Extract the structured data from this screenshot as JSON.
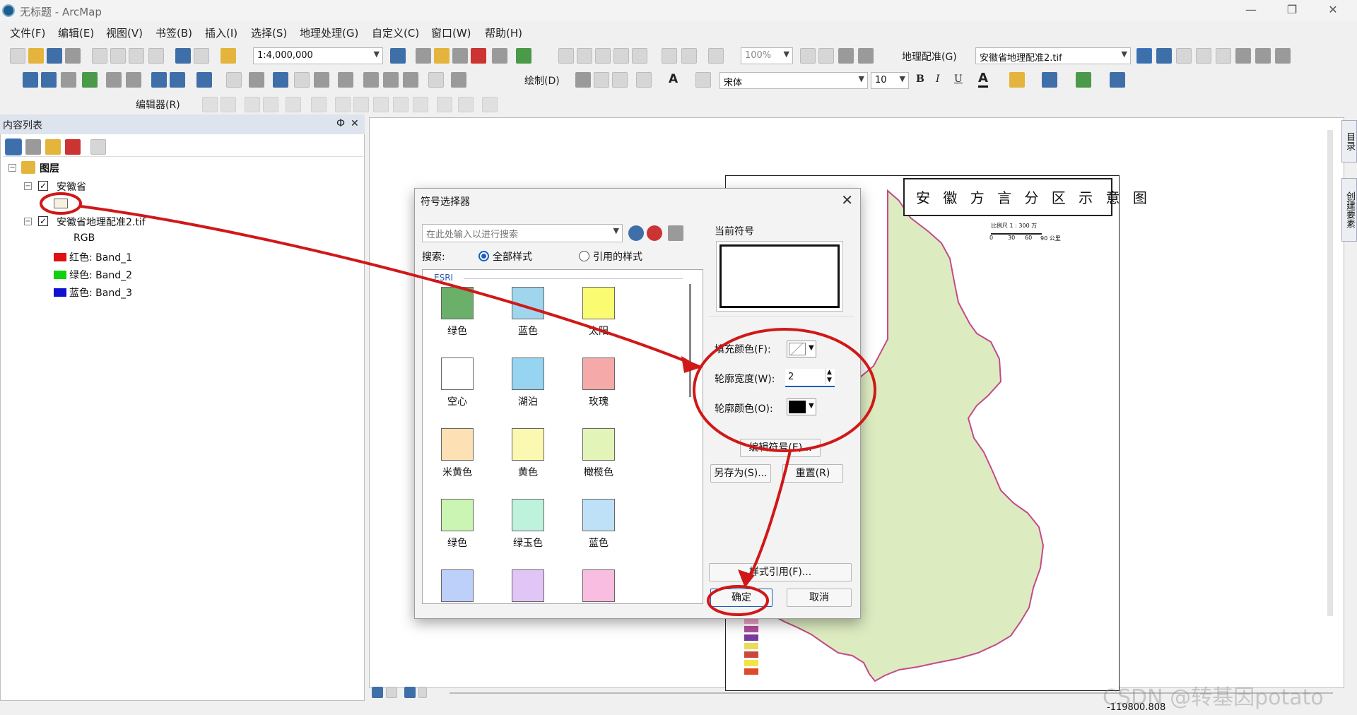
{
  "window": {
    "title": "无标题 - ArcMap"
  },
  "menu": [
    "文件(F)",
    "编辑(E)",
    "视图(V)",
    "书签(B)",
    "插入(I)",
    "选择(S)",
    "地理处理(G)",
    "自定义(C)",
    "窗口(W)",
    "帮助(H)"
  ],
  "toolbar": {
    "scale": "1:4,000,000",
    "zoom": "100%",
    "georef_label": "地理配准(G)",
    "georef_layer": "安徽省地理配准2.tif",
    "draw_label": "绘制(D)",
    "font_name": "宋体",
    "font_size": "10",
    "bold": "B",
    "italic": "I",
    "underline": "U",
    "font_color_letter": "A",
    "editor_label": "编辑器(R)"
  },
  "toc": {
    "title": "内容列表",
    "pin": "Ф",
    "close": "✕",
    "root": "图层",
    "layers": [
      {
        "name": "安徽省"
      },
      {
        "name": "安徽省地理配准2.tif",
        "rgb": "RGB",
        "bands": [
          {
            "label": "红色:   Band_1",
            "color": "#e01010"
          },
          {
            "label": "绿色: Band_2",
            "color": "#10d010"
          },
          {
            "label": "蓝色:   Band_3",
            "color": "#1010d0"
          }
        ]
      }
    ]
  },
  "map": {
    "title": "安 徽 方 言 分 区 示 意 图",
    "scale_note": "比例尺 1 : 300 万",
    "scale_ticks": [
      "0",
      "30",
      "60",
      "90 公里"
    ],
    "fill_color": "#dcebc0",
    "coordinate": "-119800.808"
  },
  "dialog": {
    "title": "符号选择器",
    "close": "✕",
    "search_placeholder": "在此处输入以进行搜索",
    "search_label": "搜索:",
    "radio_all": "全部样式",
    "radio_ref": "引用的样式",
    "group": "ESRI",
    "symbols": [
      {
        "label": "绿色",
        "color": "#6aaf6a"
      },
      {
        "label": "蓝色",
        "color": "#9fd6ee"
      },
      {
        "label": "太阳",
        "color": "#fbfb72"
      },
      {
        "label": "空心",
        "color": "#ffffff"
      },
      {
        "label": "湖泊",
        "color": "#97d4f2"
      },
      {
        "label": "玫瑰",
        "color": "#f6a9a9"
      },
      {
        "label": "米黄色",
        "color": "#fde0b4"
      },
      {
        "label": "黄色",
        "color": "#fbf8b2"
      },
      {
        "label": "橄榄色",
        "color": "#e3f4b8"
      },
      {
        "label": "绿色",
        "color": "#cbf5b3"
      },
      {
        "label": "绿玉色",
        "color": "#bff2dc"
      },
      {
        "label": "蓝色",
        "color": "#bee1f7"
      },
      {
        "label": "",
        "color": "#bdd0f9"
      },
      {
        "label": "",
        "color": "#e0c5f6"
      },
      {
        "label": "",
        "color": "#f8bde0"
      }
    ],
    "current_symbol_label": "当前符号",
    "fill_color_label": "填充颜色(F):",
    "outline_width_label": "轮廓宽度(W):",
    "outline_width_value": "2",
    "outline_color_label": "轮廓颜色(O):",
    "edit_symbol": "编辑符号(E)...",
    "save_as": "另存为(S)...",
    "reset": "重置(R)",
    "style_refs": "样式引用(F)...",
    "ok": "确定",
    "cancel": "取消"
  },
  "side_tabs": [
    "目录",
    "创建要素"
  ],
  "watermark": "CSDN @转基因potato",
  "annotation_color": "#d01818"
}
